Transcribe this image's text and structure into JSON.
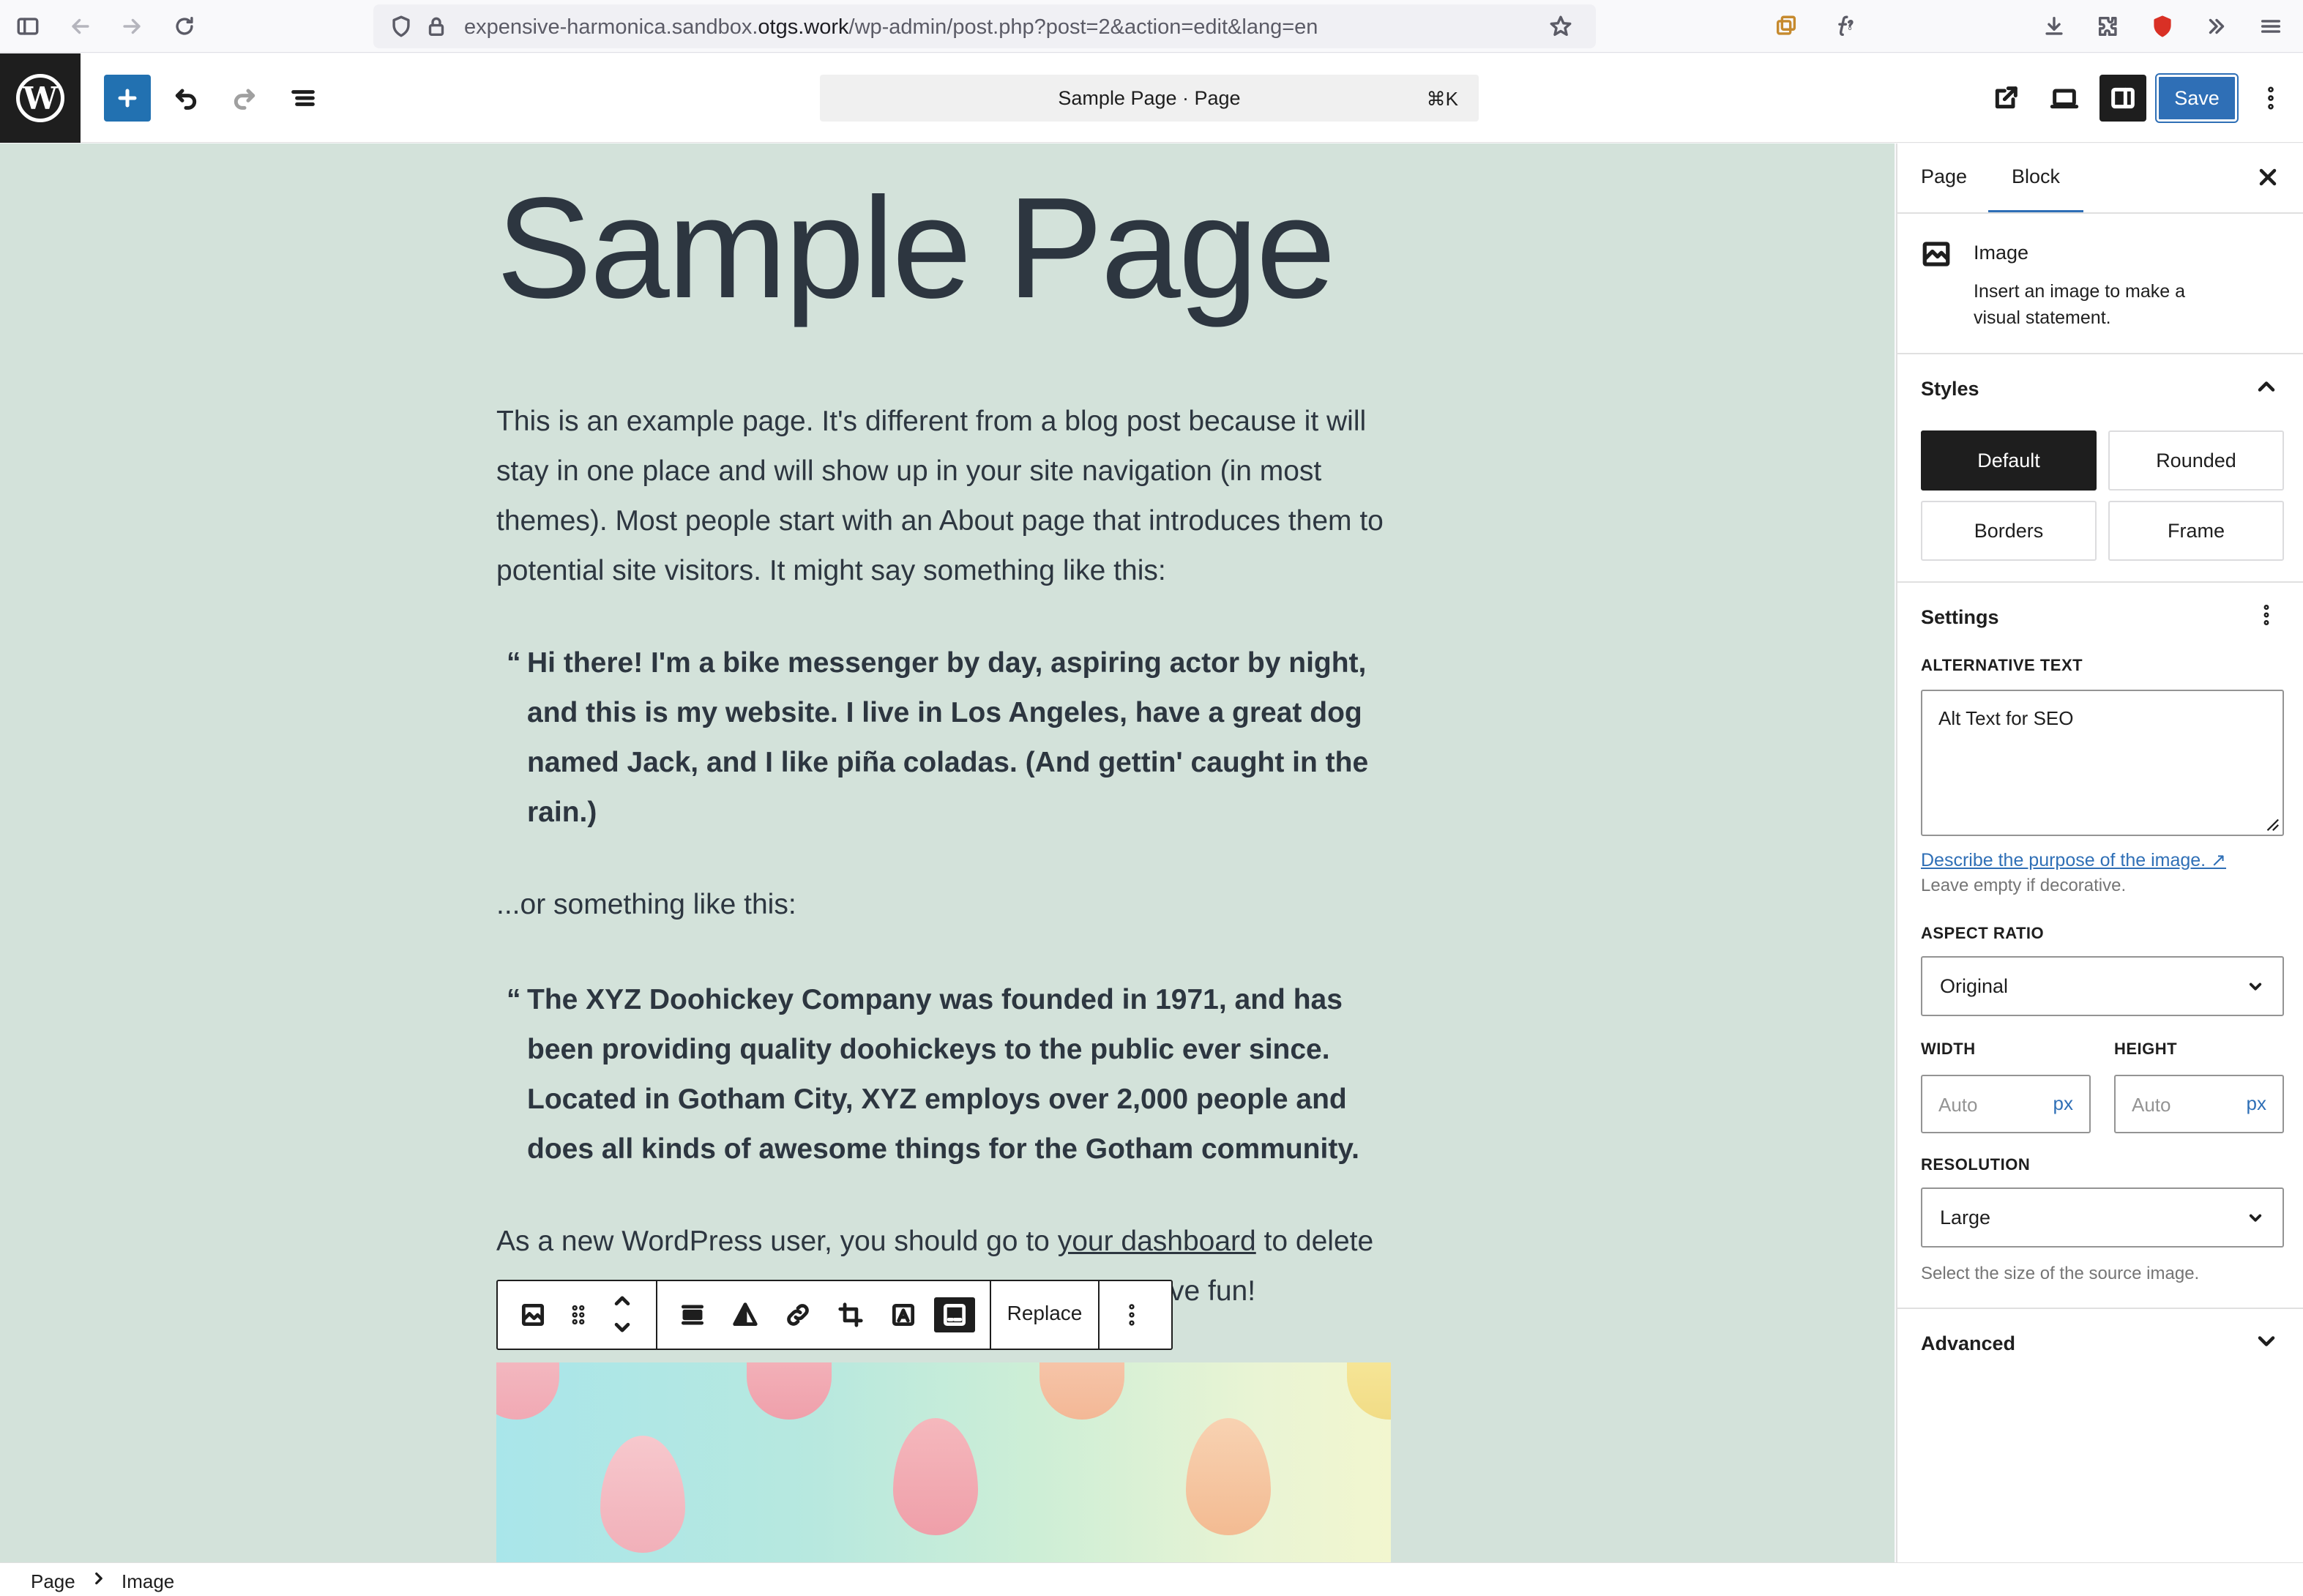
{
  "browser": {
    "url_prefix": "expensive-harmonica.sandbox.",
    "url_domain": "otgs.work",
    "url_path": "/wp-admin/post.php?post=2&action=edit&lang=en"
  },
  "header": {
    "document_title": "Sample Page · Page",
    "shortcut": "⌘K",
    "save_label": "Save"
  },
  "content": {
    "title": "Sample Page",
    "intro": "This is an example page. It's different from a blog post because it will stay in one place and will show up in your site navigation (in most themes). Most people start with an About page that introduces them to potential site visitors. It might say something like this:",
    "quote_mark": "“",
    "quote1": "Hi there! I'm a bike messenger by day, aspiring actor by night, and this is my website. I live in Los Angeles, have a great dog named Jack, and I like piña coladas. (And gettin' caught in the rain.)",
    "middle": "...or something like this:",
    "quote2": "The XYZ Doohickey Company was founded in 1971, and has been providing quality doohickeys to the public ever since. Located in Gotham City, XYZ employs over 2,000 people and does all kinds of awesome things for the Gotham community.",
    "outro_start": "As a new WordPress user, you should go to ",
    "outro_link": "your dashboard",
    "outro_end": " to delete",
    "outro_line2_visible": "ve fun!"
  },
  "toolbar": {
    "replace_label": "Replace"
  },
  "sidebar": {
    "tabs": [
      "Page",
      "Block"
    ],
    "active_tab": "Block",
    "block_name": "Image",
    "block_desc": "Insert an image to make a visual statement.",
    "styles_title": "Styles",
    "styles": [
      "Default",
      "Rounded",
      "Borders",
      "Frame"
    ],
    "active_style": "Default",
    "settings_title": "Settings",
    "alt_label": "ALTERNATIVE TEXT",
    "alt_value": "Alt Text for SEO",
    "alt_help_link": "Describe the purpose of the image. ↗",
    "alt_help": "Leave empty if decorative.",
    "aspect_label": "ASPECT RATIO",
    "aspect_value": "Original",
    "width_label": "WIDTH",
    "height_label": "HEIGHT",
    "width_placeholder": "Auto",
    "height_placeholder": "Auto",
    "unit": "px",
    "resolution_label": "RESOLUTION",
    "resolution_value": "Large",
    "resolution_help": "Select the size of the source image.",
    "advanced_title": "Advanced"
  },
  "breadcrumb": [
    "Page",
    "Image"
  ],
  "colors": {
    "canvas_bg": "#d3e2da",
    "accent": "#2f6fb6",
    "text": "#2d3640"
  }
}
